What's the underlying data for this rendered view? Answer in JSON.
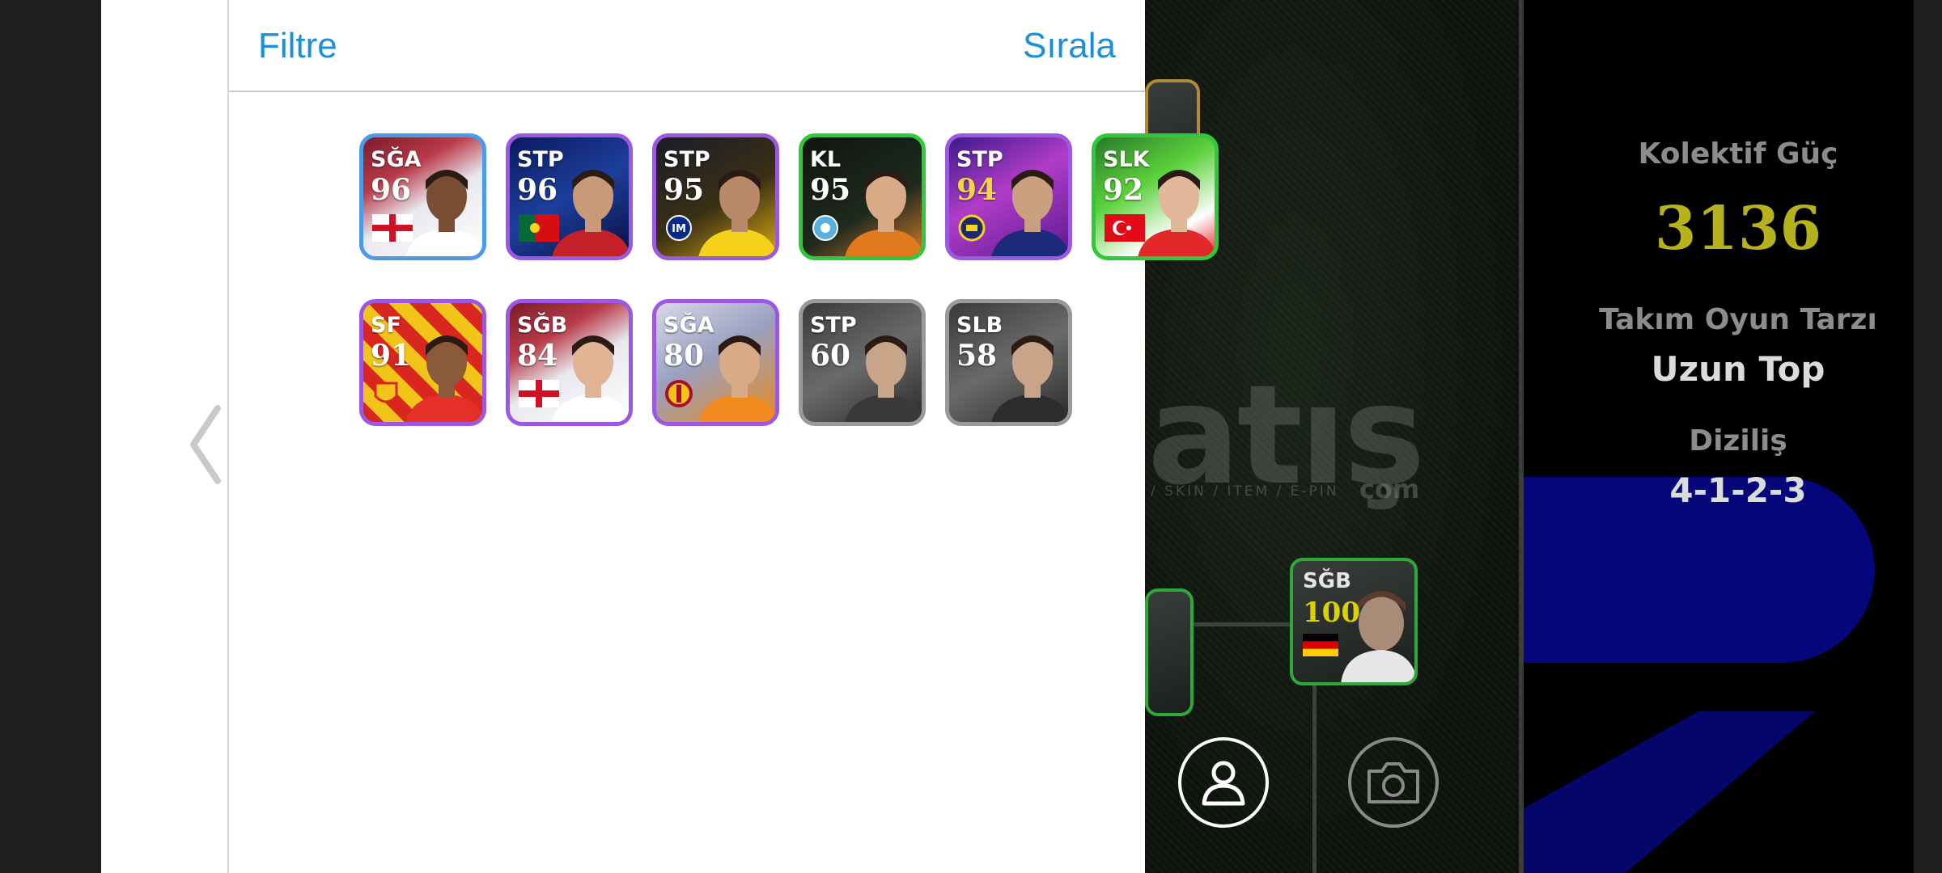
{
  "header": {
    "filter_label": "Filtre",
    "sort_label": "Sırala"
  },
  "colors": {
    "accent_blue": "#1d8fd8",
    "power_gold": "#b6b21c",
    "rarity_purple": "#9c59e0",
    "rarity_blue": "#4a9be8",
    "rarity_green": "#2fc93c",
    "rarity_grey": "#9a9a9a"
  },
  "players": [
    {
      "position": "SĞA",
      "rating": "96",
      "rarity": "blue",
      "badge": "flag-england",
      "bg": "white"
    },
    {
      "position": "STP",
      "rating": "96",
      "rarity": "purple",
      "badge": "flag-portugal",
      "bg": "navy"
    },
    {
      "position": "STP",
      "rating": "95",
      "rarity": "purple",
      "badge": "club-inter",
      "bg": "dark"
    },
    {
      "position": "KL",
      "rating": "95",
      "rarity": "green",
      "badge": "club-blue-crest",
      "bg": "black"
    },
    {
      "position": "STP",
      "rating": "94",
      "rarity": "purple",
      "badge": "club-fenerbahce",
      "bg": "violet",
      "gold": true
    },
    {
      "position": "SLK",
      "rating": "92",
      "rarity": "green",
      "badge": "flag-turkey",
      "bg": "green"
    },
    {
      "position": "SF",
      "rating": "91",
      "rarity": "purple",
      "badge": "club-goztepe",
      "bg": "redyellow"
    },
    {
      "position": "SĞB",
      "rating": "84",
      "rarity": "purple",
      "badge": "flag-england",
      "bg": "white"
    },
    {
      "position": "SĞA",
      "rating": "80",
      "rarity": "purple",
      "badge": "club-galatasaray",
      "bg": "orange"
    },
    {
      "position": "STP",
      "rating": "60",
      "rarity": "grey",
      "badge": "none",
      "bg": "grey"
    },
    {
      "position": "SLB",
      "rating": "58",
      "rarity": "grey",
      "badge": "none",
      "bg": "grey"
    }
  ],
  "team_panel": {
    "collective_label": "Kolektif Güç",
    "collective_value": "3136",
    "playstyle_label": "Takım Oyun Tarzı",
    "playstyle_value": "Uzun Top",
    "formation_label": "Diziliş",
    "formation_value": "4-1-2-3"
  },
  "pitch_card": {
    "position": "SĞB",
    "rating": "100",
    "badge": "flag-germany"
  },
  "watermark": {
    "text": "atış",
    "suffix": "com",
    "sub": "/ SKIN / ITEM / E-PIN"
  },
  "icons": {
    "profile_button": "person-icon",
    "camera_button": "camera-icon",
    "back": "chevron-left-icon"
  }
}
